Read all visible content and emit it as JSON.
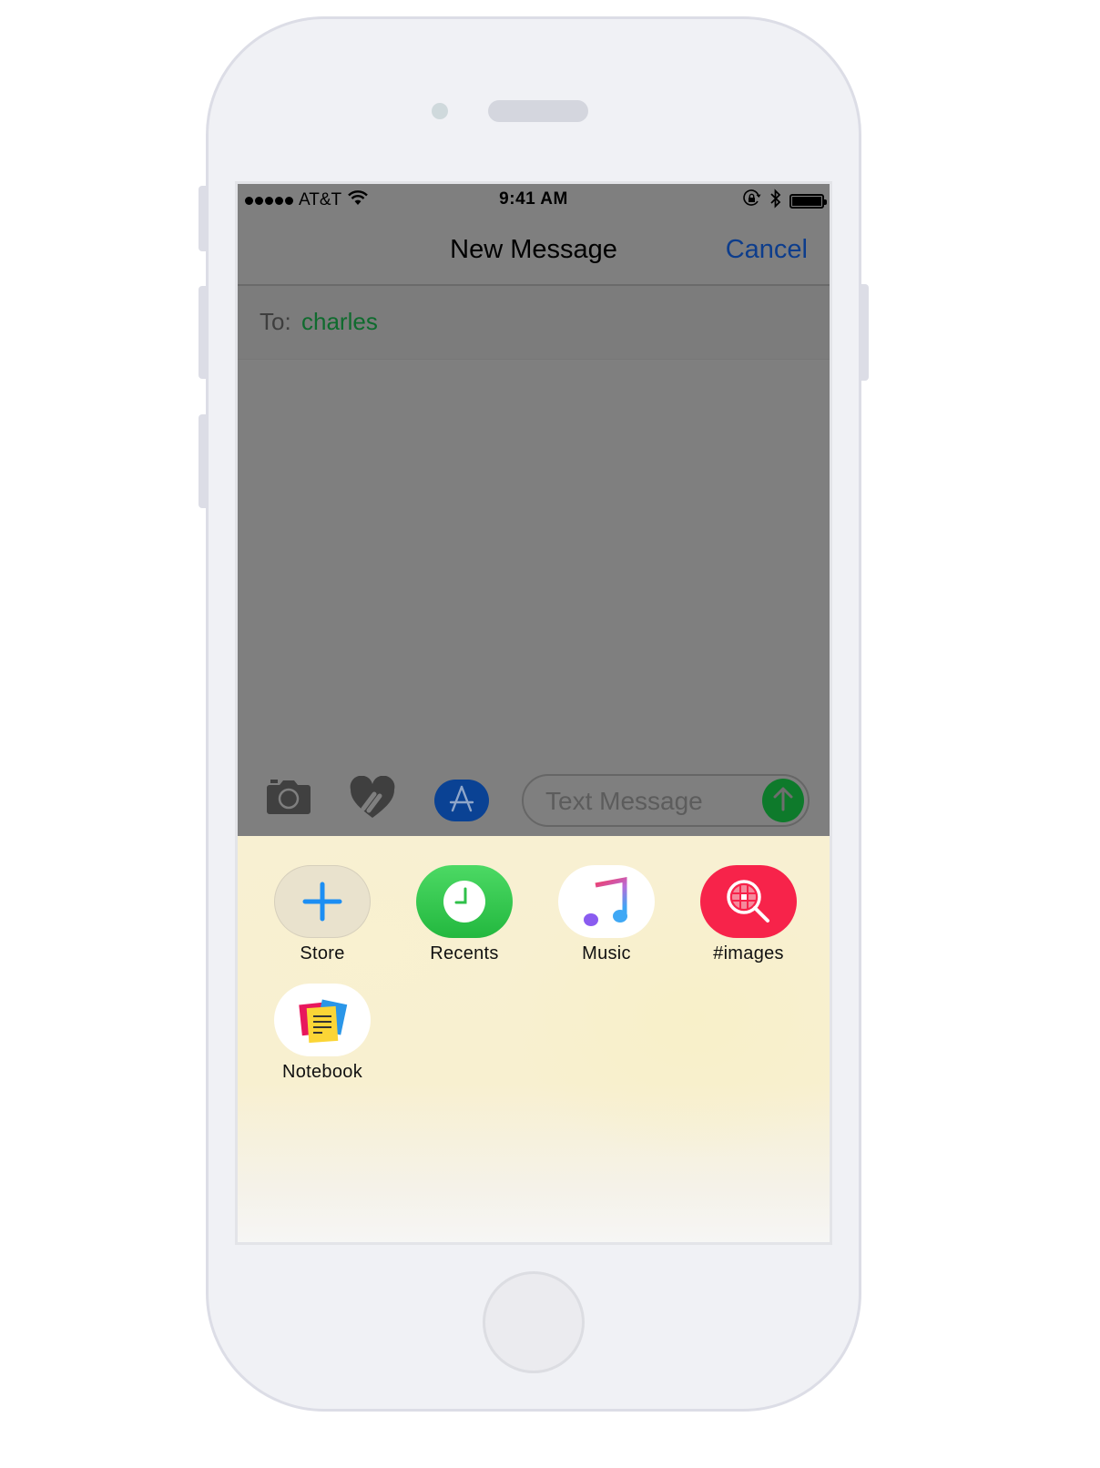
{
  "status_bar": {
    "carrier": "AT&T",
    "signal_bars": 5,
    "time": "9:41 AM",
    "icons": [
      "wifi-icon",
      "rotation-lock-icon",
      "bluetooth-icon",
      "battery-icon"
    ],
    "battery_level": 1.0
  },
  "nav": {
    "title": "New Message",
    "cancel_label": "Cancel"
  },
  "recipient": {
    "label": "To:",
    "value": "charles"
  },
  "compose": {
    "placeholder": "Text Message",
    "value": "",
    "buttons": [
      "camera-icon",
      "digital-touch-icon",
      "app-store-icon",
      "send-icon"
    ]
  },
  "app_drawer": {
    "apps": [
      {
        "label": "Store",
        "icon": "plus-icon"
      },
      {
        "label": "Recents",
        "icon": "clock-icon"
      },
      {
        "label": "Music",
        "icon": "music-note-icon"
      },
      {
        "label": "#images",
        "icon": "image-search-icon"
      },
      {
        "label": "Notebook",
        "icon": "notebook-icon"
      }
    ]
  },
  "colors": {
    "accent_blue": "#0d3d8c",
    "recipient_green": "#0f6b2e",
    "send_green": "#0e7a2b",
    "dim_overlay": "#7f7f7f"
  }
}
